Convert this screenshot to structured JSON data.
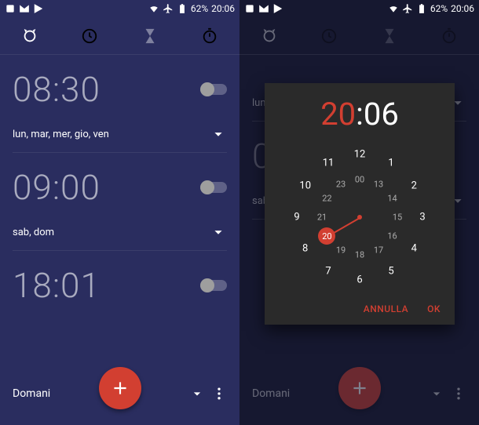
{
  "status": {
    "battery": "62%",
    "time": "20:06"
  },
  "alarms": [
    {
      "time": "08:30",
      "days": "lun, mar, mer, gio, ven"
    },
    {
      "time": "09:00",
      "days": "sab, dom"
    },
    {
      "time": "18:01",
      "days": ""
    }
  ],
  "bottom_label": "Domani",
  "picker": {
    "hour": "20",
    "minute": "06",
    "cancel": "ANNULLA",
    "ok": "OK",
    "outer": [
      "12",
      "1",
      "2",
      "3",
      "4",
      "5",
      "6",
      "7",
      "8",
      "9",
      "10",
      "11"
    ],
    "inner": [
      "00",
      "13",
      "14",
      "15",
      "16",
      "17",
      "18",
      "19",
      "20",
      "21",
      "22",
      "23"
    ]
  }
}
